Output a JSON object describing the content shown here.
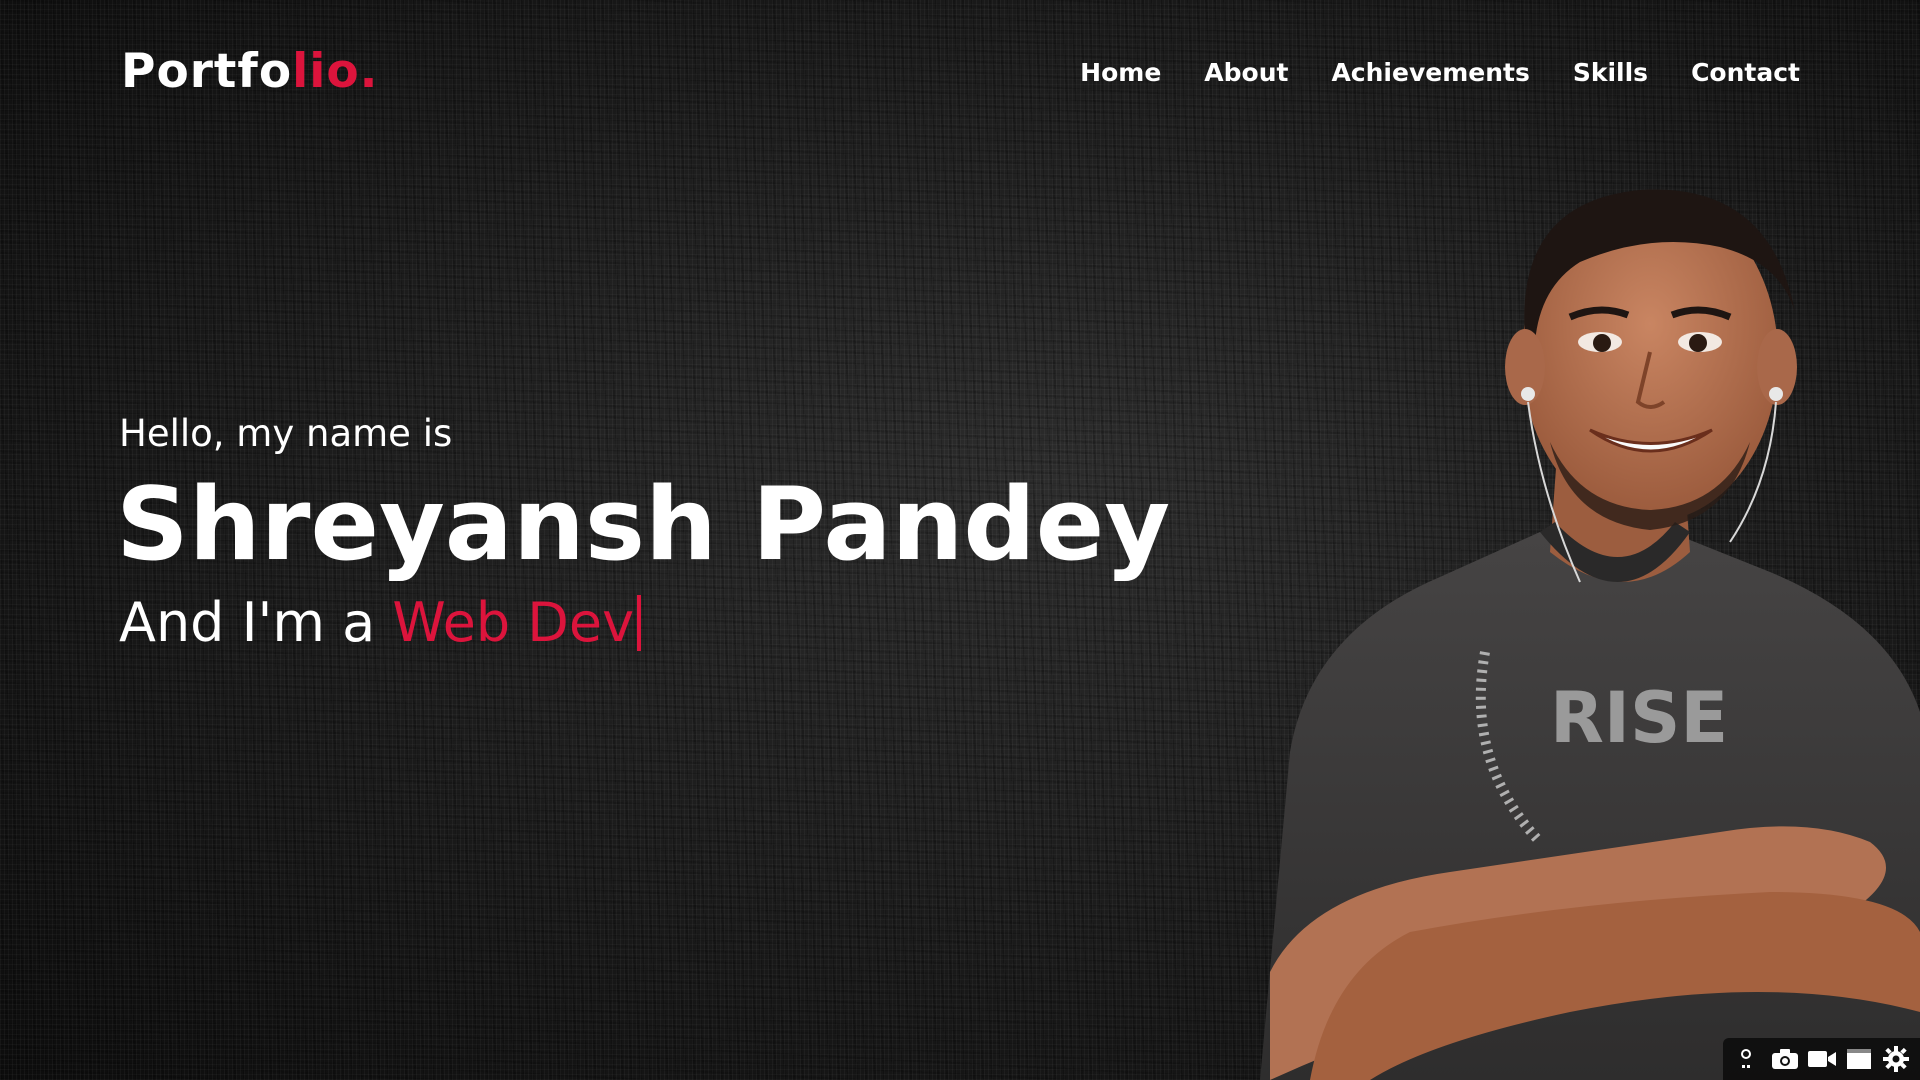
{
  "brand": {
    "logo_main": "Portfo",
    "logo_accent": "lio."
  },
  "nav": {
    "items": [
      {
        "label": "Home"
      },
      {
        "label": "About"
      },
      {
        "label": "Achievements"
      },
      {
        "label": "Skills"
      },
      {
        "label": "Contact"
      }
    ]
  },
  "hero": {
    "greeting": "Hello, my name is",
    "name": "Shreyansh Pandey",
    "role_prefix": "And I'm a ",
    "role_typed": "Web Dev",
    "shirt_text": "RISE"
  },
  "toolbar": {
    "icons": [
      "edit-icon",
      "camera-icon",
      "video-icon",
      "window-icon",
      "gear-icon"
    ]
  },
  "colors": {
    "accent": "#dc143c",
    "background": "#161616",
    "text": "#ffffff",
    "shirt": "#3a3a3a"
  }
}
